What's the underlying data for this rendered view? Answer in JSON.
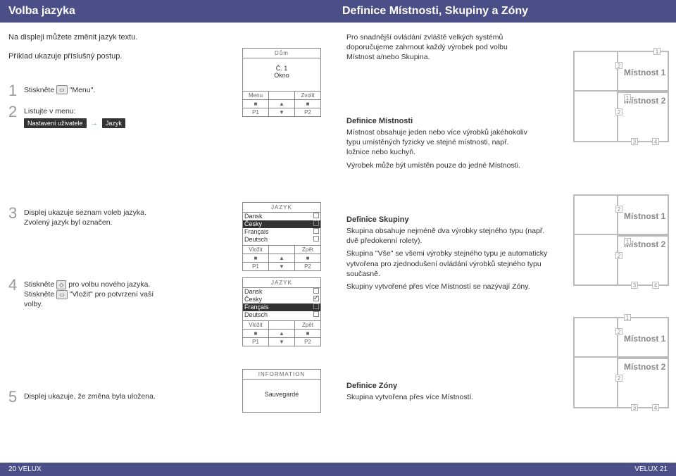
{
  "left": {
    "title": "Volba jazyka",
    "intro1": "Na displeji můžete změnit jazyk textu.",
    "intro2": "Příklad ukazuje příslušný postup.",
    "steps": {
      "s1": "Stiskněte",
      "s1b": "\"Menu\".",
      "s2a": "Listujte v menu:",
      "s2tag1": "Nastavení uživatele",
      "s2tag2": "Jazyk",
      "s3": "Displej ukazuje seznam voleb jazyka. Zvolený jazyk byl označen.",
      "s4a": "Stiskněte",
      "s4b": "pro volbu nového jazyka.",
      "s4c": "Stiskněte",
      "s4d": "\"Vložit\" pro potvrzení vaší volby.",
      "s5": "Displej ukazuje, že změna byla uložena."
    },
    "screen": {
      "hdr_dum": "Dům",
      "okno_c": "Č. 1",
      "okno": "Okno",
      "menu": "Menu",
      "zvolit": "Zvolit",
      "p1": "P1",
      "p2": "P2",
      "up": "▲",
      "dn": "▼",
      "sq": "■",
      "jazyk": "JAZYK",
      "dansk": "Dansk",
      "cesky": "Česky",
      "francais": "Français",
      "deutsch": "Deutsch",
      "vlozit": "Vložit",
      "zpet": "Zpět",
      "info": "INFORMATION",
      "saved": "Sauvegardé"
    },
    "footer": "20  VELUX"
  },
  "right": {
    "title": "Definice Místnosti, Skupiny a Zóny",
    "intro": "Pro snadnější ovládání zvláště velkých systémů doporučujeme zahrnout každý výrobek pod volbu Místnost a/nebo Skupina.",
    "def_mistnost_t": "Definice Místnosti",
    "def_mistnost": "Místnost obsahuje jeden nebo více výrobků jakéhokoliv typu umístěných fyzicky ve stejné místnosti, např. ložnice nebo kuchyň.",
    "def_mistnost2": "Výrobek může být umístěn pouze do jedné Místnosti.",
    "def_skupiny_t": "Definice Skupiny",
    "def_skupiny1": "Skupina obsahuje nejméně dva výrobky stejného typu (např. dvě předokenní rolety).",
    "def_skupiny2": "Skupina \"Vše\" se všemi výrobky stejného typu je automaticky vytvořena pro zjednodušení ovládání výrobků stejného typu současně.",
    "def_skupiny3": "Skupiny vytvořené přes více Místností se nazývají Zóny.",
    "def_zony_t": "Definice Zóny",
    "def_zony": "Skupina vytvořena přes více Místností.",
    "room1": "Místnost 1",
    "room2": "Místnost 2",
    "n1": "1",
    "n2": "2",
    "n3": "3",
    "n4": "4",
    "footer": "VELUX  21"
  }
}
